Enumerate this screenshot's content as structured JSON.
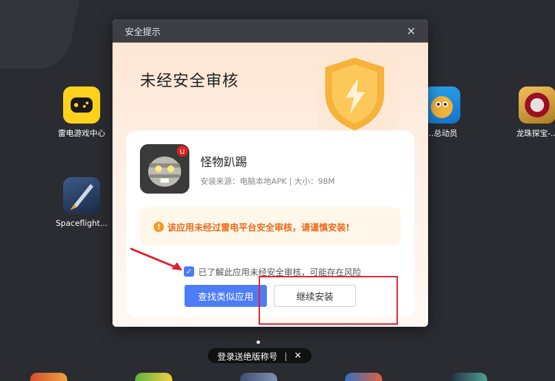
{
  "desktop": {
    "icons": [
      {
        "label": "雷电游戏中心",
        "icon": "gamepad-icon"
      },
      {
        "label": "Spaceflight...",
        "icon": "rocket-icon"
      },
      {
        "label": "...总动员",
        "icon": "cartoon-app-icon"
      },
      {
        "label": "龙珠探宝-...",
        "icon": "gem-app-icon"
      }
    ]
  },
  "dialog": {
    "title": "安全提示",
    "heading": "未经安全审核",
    "app": {
      "name": "怪物趴踢",
      "source_info": "安装来源：电脑本地APK | 大小：98M"
    },
    "warning": "该应用未经过雷电平台安全审核，请谨慎安装!",
    "agree_text": "已了解此应用未经安全审核，可能存在风险",
    "agree_checked": true,
    "find_similar_label": "查找类似应用",
    "continue_label": "继续安装"
  },
  "tooltip": {
    "text": "登录送绝版称号",
    "separator": "|",
    "close": "✕"
  },
  "colors": {
    "accent": "#4e7bf6",
    "warning": "#ea6a1a",
    "annotation": "#e4202c"
  }
}
